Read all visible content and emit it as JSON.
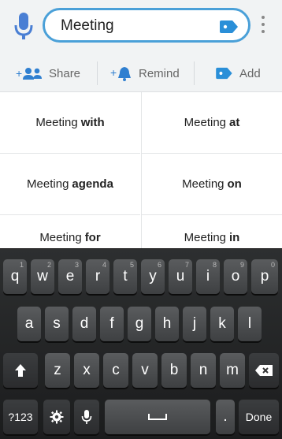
{
  "search": {
    "query": "Meeting"
  },
  "actions": [
    {
      "label": "Share",
      "icon": "people-icon"
    },
    {
      "label": "Remind",
      "icon": "bell-icon"
    },
    {
      "label": "Add",
      "icon": "tag-icon"
    }
  ],
  "suggestions": [
    {
      "prefix": "Meeting",
      "bold": "with"
    },
    {
      "prefix": "Meeting",
      "bold": "at"
    },
    {
      "prefix": "Meeting",
      "bold": "agenda"
    },
    {
      "prefix": "Meeting",
      "bold": "on"
    },
    {
      "prefix": "Meeting",
      "bold": "for"
    },
    {
      "prefix": "Meeting",
      "bold": "in"
    }
  ],
  "keyboard": {
    "row1": [
      {
        "key": "q",
        "num": "1"
      },
      {
        "key": "w",
        "num": "2"
      },
      {
        "key": "e",
        "num": "3"
      },
      {
        "key": "r",
        "num": "4"
      },
      {
        "key": "t",
        "num": "5"
      },
      {
        "key": "y",
        "num": "6"
      },
      {
        "key": "u",
        "num": "7"
      },
      {
        "key": "i",
        "num": "8"
      },
      {
        "key": "o",
        "num": "9"
      },
      {
        "key": "p",
        "num": "0"
      }
    ],
    "row2": [
      "a",
      "s",
      "d",
      "f",
      "g",
      "h",
      "j",
      "k",
      "l"
    ],
    "row3": [
      "z",
      "x",
      "c",
      "v",
      "b",
      "n",
      "m"
    ],
    "symbols_label": "?123",
    "period_label": ".",
    "done_label": "Done"
  },
  "colors": {
    "accent": "#4aa0d8",
    "keyboard_bg": "#1f2021",
    "key_bg": "#4a4c4e"
  }
}
